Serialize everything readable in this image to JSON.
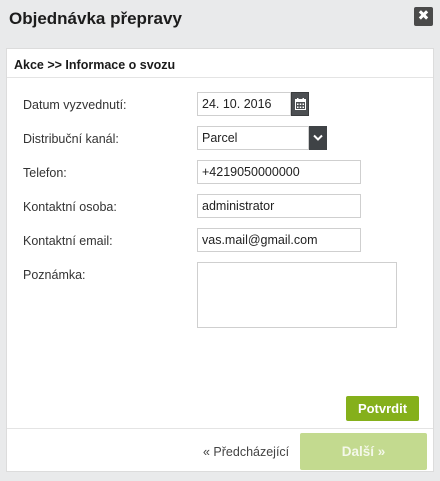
{
  "dialog": {
    "title": "Objednávka přepravy",
    "close_glyph": "✖"
  },
  "breadcrumb": "Akce >> Informace o svozu",
  "form": {
    "pickup_date": {
      "label": "Datum vyzvednutí:",
      "value": "24. 10. 2016",
      "icon": "calendar-icon"
    },
    "channel": {
      "label": "Distribuční kanál:",
      "value": "Parcel",
      "icon": "chevron-down-icon"
    },
    "phone": {
      "label": "Telefon:",
      "value": "+4219050000000"
    },
    "contact_person": {
      "label": "Kontaktní osoba:",
      "value": "administrator"
    },
    "contact_email": {
      "label": "Kontaktní email:",
      "value": "vas.mail@gmail.com"
    },
    "note": {
      "label": "Poznámka:",
      "value": ""
    }
  },
  "actions": {
    "confirm_label": "Potvrdit",
    "prev_label": "« Předcházející",
    "next_label": "Další »"
  },
  "colors": {
    "accent_green": "#85b01b",
    "disabled_green": "#c3da8f"
  }
}
